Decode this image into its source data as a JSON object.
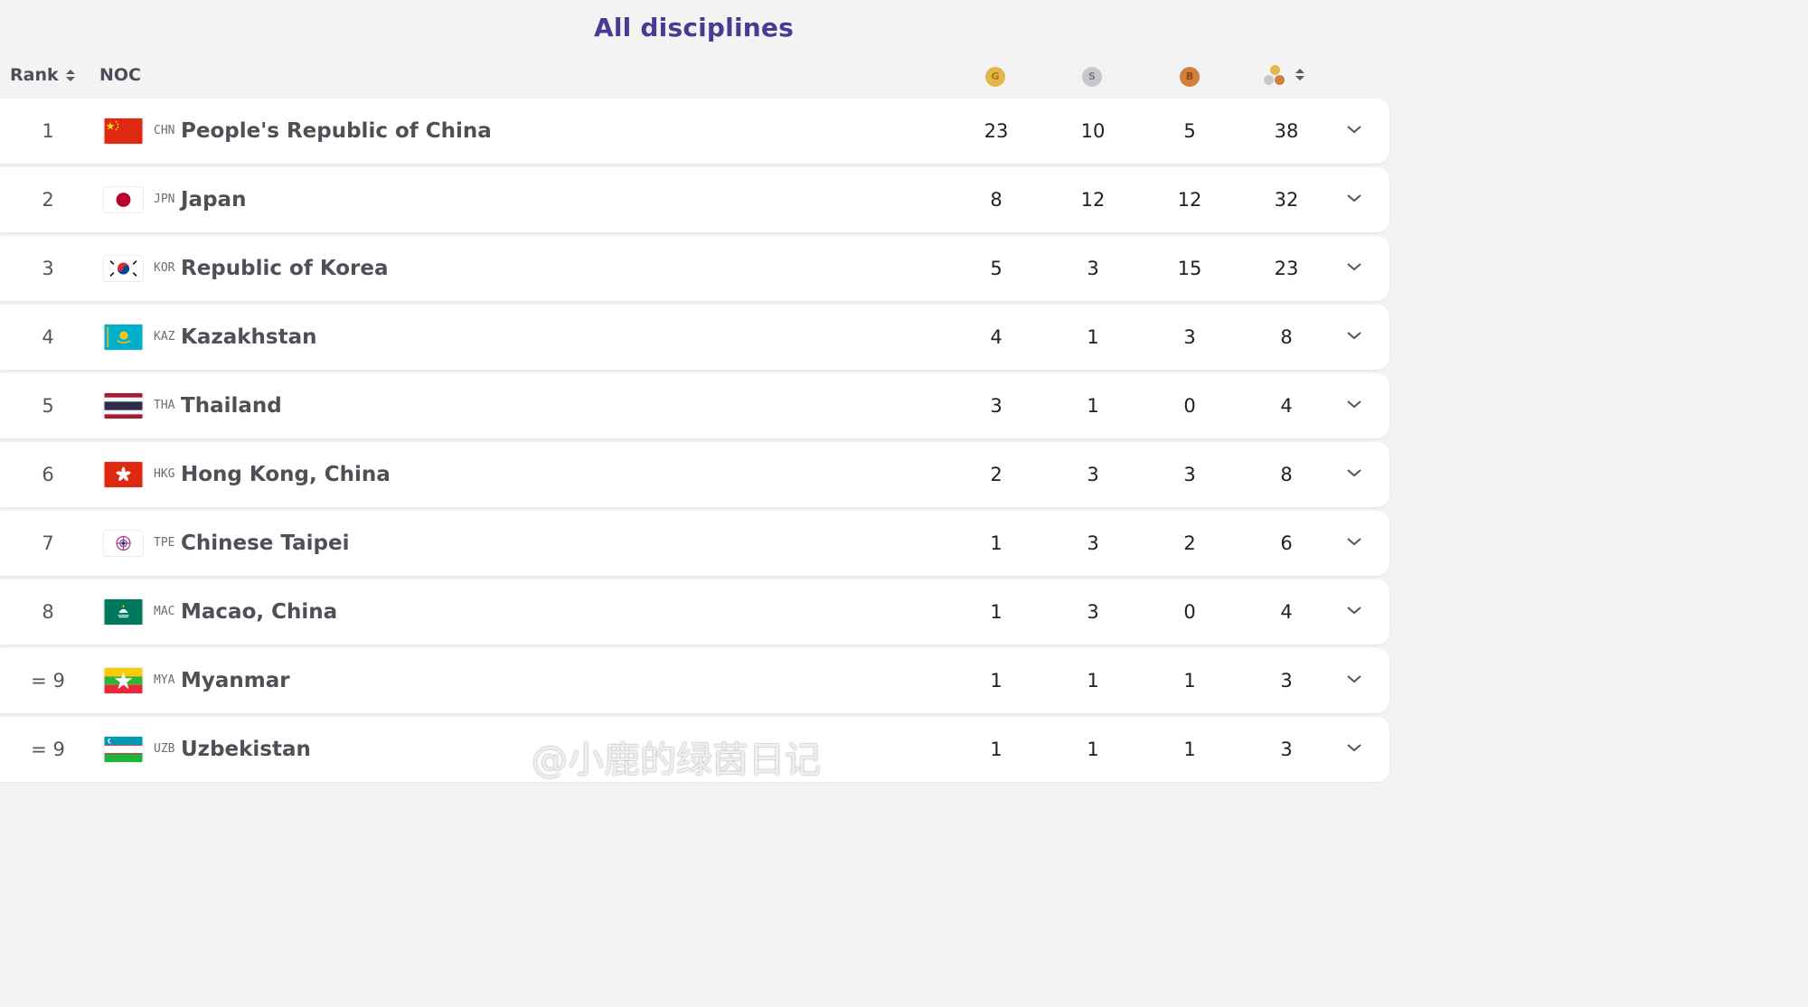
{
  "page": {
    "title": "All disciplines"
  },
  "header": {
    "rank_label": "Rank",
    "noc_label": "NOC",
    "gold_letter": "G",
    "silver_letter": "S",
    "bronze_letter": "B"
  },
  "colors": {
    "title": "#4a3a93",
    "gold": "#e5b64b",
    "silver": "#c8c8cc",
    "bronze": "#cf7f3e"
  },
  "rows": [
    {
      "rank": "1",
      "code": "CHN",
      "name": "People's Republic of China",
      "gold": "23",
      "silver": "10",
      "bronze": "5",
      "total": "38",
      "flag": "china-flag"
    },
    {
      "rank": "2",
      "code": "JPN",
      "name": "Japan",
      "gold": "8",
      "silver": "12",
      "bronze": "12",
      "total": "32",
      "flag": "japan-flag"
    },
    {
      "rank": "3",
      "code": "KOR",
      "name": "Republic of Korea",
      "gold": "5",
      "silver": "3",
      "bronze": "15",
      "total": "23",
      "flag": "korea-flag"
    },
    {
      "rank": "4",
      "code": "KAZ",
      "name": "Kazakhstan",
      "gold": "4",
      "silver": "1",
      "bronze": "3",
      "total": "8",
      "flag": "kazakhstan-flag"
    },
    {
      "rank": "5",
      "code": "THA",
      "name": "Thailand",
      "gold": "3",
      "silver": "1",
      "bronze": "0",
      "total": "4",
      "flag": "thailand-flag"
    },
    {
      "rank": "6",
      "code": "HKG",
      "name": "Hong Kong, China",
      "gold": "2",
      "silver": "3",
      "bronze": "3",
      "total": "8",
      "flag": "hong-kong-flag"
    },
    {
      "rank": "7",
      "code": "TPE",
      "name": "Chinese Taipei",
      "gold": "1",
      "silver": "3",
      "bronze": "2",
      "total": "6",
      "flag": "chinese-taipei-flag"
    },
    {
      "rank": "8",
      "code": "MAC",
      "name": "Macao, China",
      "gold": "1",
      "silver": "3",
      "bronze": "0",
      "total": "4",
      "flag": "macao-flag"
    },
    {
      "rank": "= 9",
      "code": "MYA",
      "name": "Myanmar",
      "gold": "1",
      "silver": "1",
      "bronze": "1",
      "total": "3",
      "flag": "myanmar-flag"
    },
    {
      "rank": "= 9",
      "code": "UZB",
      "name": "Uzbekistan",
      "gold": "1",
      "silver": "1",
      "bronze": "1",
      "total": "3",
      "flag": "uzbekistan-flag"
    }
  ],
  "watermark": "@小鹿的绿茵日记"
}
